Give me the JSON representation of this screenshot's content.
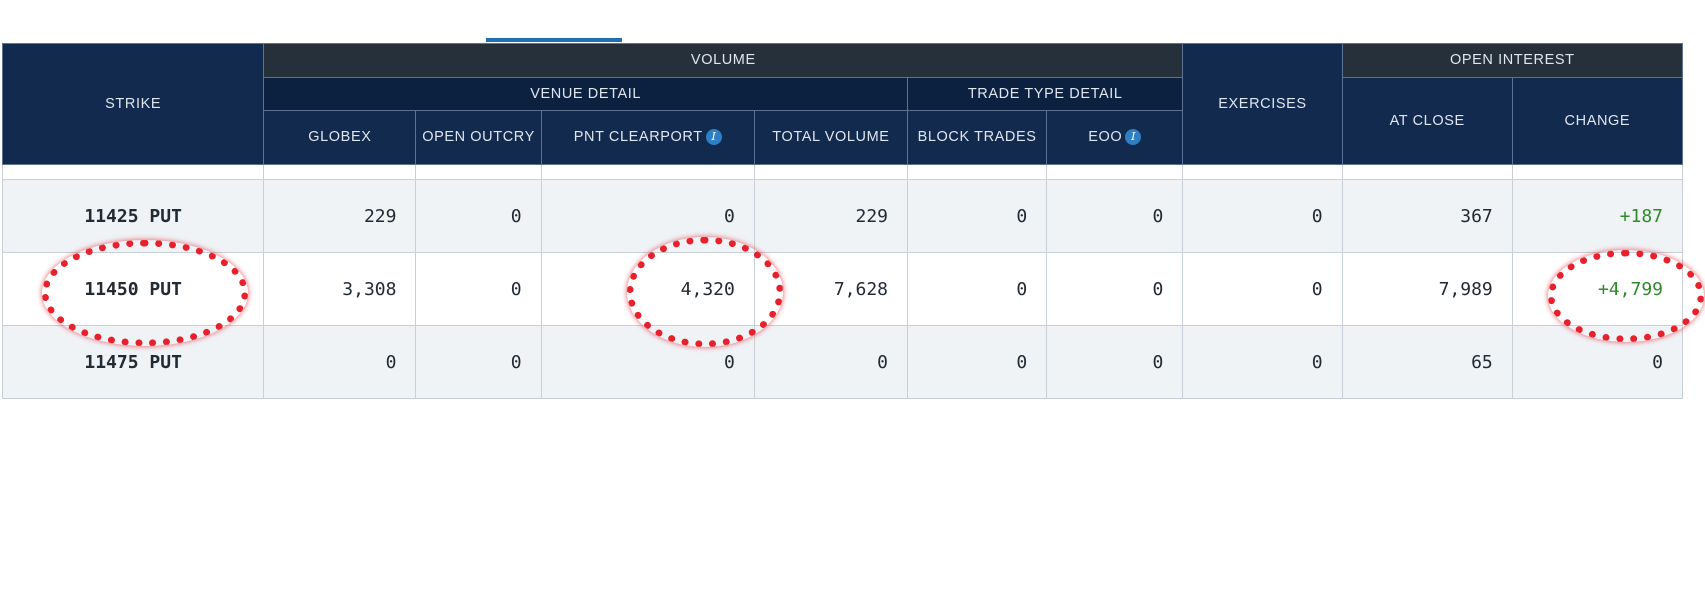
{
  "table": {
    "headers": {
      "strike": "STRIKE",
      "volume": "VOLUME",
      "venue_detail": "VENUE DETAIL",
      "trade_type_detail": "TRADE TYPE DETAIL",
      "exercises": "EXERCISES",
      "open_interest": "OPEN INTEREST",
      "globex": "GLOBEX",
      "open_outcry": "OPEN OUTCRY",
      "pnt_clearport": "PNT CLEARPORT",
      "total_volume": "TOTAL VOLUME",
      "block_trades": "BLOCK TRADES",
      "eoo": "EOO",
      "at_close": "AT CLOSE",
      "change": "CHANGE"
    },
    "info_icon_glyph": "i",
    "rows": [
      {
        "strike": "11425 PUT",
        "globex": "229",
        "open_outcry": "0",
        "pnt_clearport": "0",
        "total_volume": "229",
        "block_trades": "0",
        "eoo": "0",
        "exercises": "0",
        "at_close": "367",
        "change": "+187"
      },
      {
        "strike": "11450 PUT",
        "globex": "3,308",
        "open_outcry": "0",
        "pnt_clearport": "4,320",
        "total_volume": "7,628",
        "block_trades": "0",
        "eoo": "0",
        "exercises": "0",
        "at_close": "7,989",
        "change": "+4,799"
      },
      {
        "strike": "11475 PUT",
        "globex": "0",
        "open_outcry": "0",
        "pnt_clearport": "0",
        "total_volume": "0",
        "block_trades": "0",
        "eoo": "0",
        "exercises": "0",
        "at_close": "65",
        "change": "0"
      }
    ]
  },
  "colors": {
    "header_bg": "#112a4e",
    "group_header_bg": "#26303a",
    "positive_change": "#2e8a2a",
    "annotation": "#e8202c",
    "tab_indicator": "#1f6fb5"
  }
}
